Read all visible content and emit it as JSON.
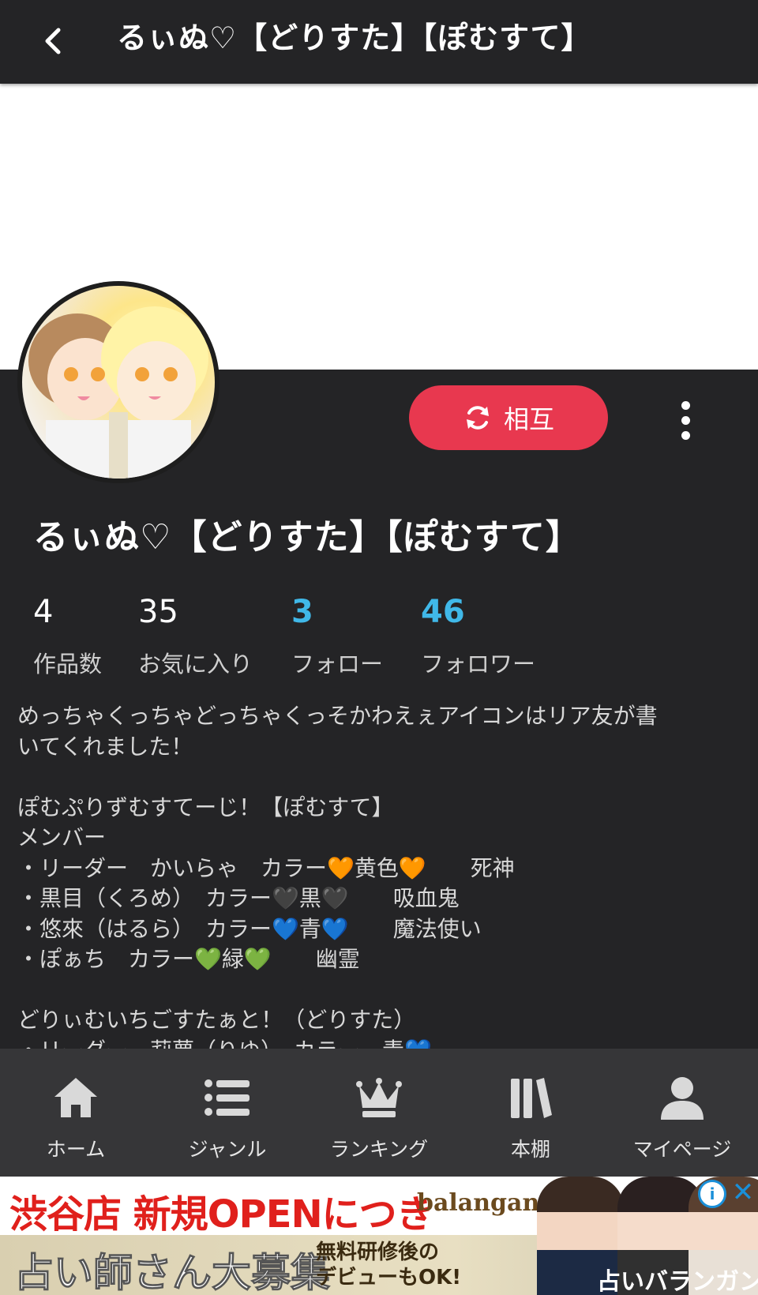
{
  "header": {
    "title": "るぃぬ♡【どりすた】【ぽむすて】",
    "back_icon": "chevron-left-icon"
  },
  "profile": {
    "name": "るぃぬ♡【どりすた】【ぽむすて】",
    "mutual_label": "相互",
    "mutual_icon": "sync-icon",
    "more_icon": "more-vertical-icon",
    "accent_color": "#e8384f",
    "link_color": "#40b8e8"
  },
  "stats": [
    {
      "value": "4",
      "label": "作品数"
    },
    {
      "value": "35",
      "label": "お気に入り"
    },
    {
      "value": "3",
      "label": "フォロー"
    },
    {
      "value": "46",
      "label": "フォロワー"
    }
  ],
  "bio": {
    "lines": [
      "めっちゃくっちゃどっちゃくっそかわえぇアイコンはリア友が書",
      "いてくれました！",
      "",
      "ぽむぷりずむすてーじ！【ぽむすて】",
      "メンバー",
      "・リーダー　かいらゃ　カラー🧡黄色🧡　　死神",
      "・黒目（くろめ）　カラー🖤黒🖤　　吸血鬼",
      "・悠來（はるら）　カラー💙青💙　　魔法使い",
      "・ぽぁち　カラー💚緑💚　　幽霊",
      "",
      "どりぃむいちごすたぁと！（どりすた）",
      "・リーダー　莉夢（りゆ）　カラー　青💙"
    ]
  },
  "bottom_nav": [
    {
      "label": "ホーム",
      "icon": "home-icon"
    },
    {
      "label": "ジャンル",
      "icon": "list-icon"
    },
    {
      "label": "ランキング",
      "icon": "crown-icon"
    },
    {
      "label": "本棚",
      "icon": "bookshelf-icon"
    },
    {
      "label": "マイページ",
      "icon": "user-icon"
    }
  ],
  "ad": {
    "headline": "渋谷店 新規OPENにつき",
    "brand": "balangan",
    "subheadline": "占い師さん大募集",
    "note_line1": "無料研修後の",
    "note_line2": "デビューもOK!",
    "tag": "占いバランガン",
    "info_icon": "info-icon",
    "close_icon": "close-icon"
  }
}
